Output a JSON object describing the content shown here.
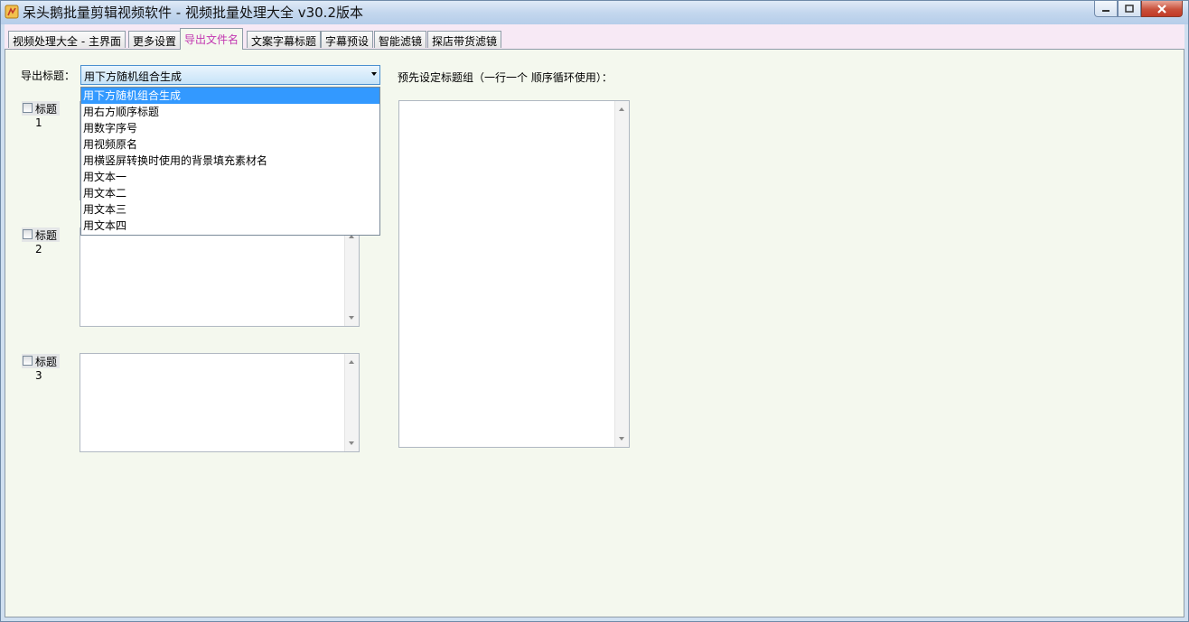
{
  "window": {
    "title": "呆头鹅批量剪辑视频软件 -  视频批量处理大全  v30.2版本",
    "icon": "goose-app-icon"
  },
  "tabs": [
    {
      "label": "视频处理大全 - 主界面"
    },
    {
      "label": "更多设置"
    },
    {
      "label": "导出文件名"
    },
    {
      "label": "文案字幕标题"
    },
    {
      "label": "字幕预设"
    },
    {
      "label": "智能滤镜"
    },
    {
      "label": "探店带货滤镜"
    }
  ],
  "active_tab": "导出文件名",
  "export": {
    "label": "导出标题：",
    "selected": "用下方随机组合生成",
    "options": [
      "用下方随机组合生成",
      "用右方顺序标题",
      "用数字序号",
      "用视频原名",
      "用横竖屏转换时使用的背景填充素材名",
      "用文本一",
      "用文本二",
      "用文本三",
      "用文本四"
    ]
  },
  "titles": [
    {
      "label": "标题1",
      "checked": false
    },
    {
      "label": "标题2",
      "checked": false
    },
    {
      "label": "标题3",
      "checked": false
    }
  ],
  "preset_group": {
    "label": "预先设定标题组（一行一个 顺序循环使用）："
  },
  "colors": {
    "active_tab_text": "#c236b0",
    "selection": "#3399ff",
    "tabstrip_bg": "#f7e9f5",
    "panel_bg": "#f4f8ee"
  }
}
